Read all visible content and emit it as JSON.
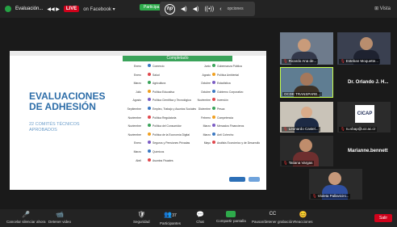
{
  "topbar": {
    "meeting_label": "Evaluación...",
    "controls": "◀◀ ▶",
    "live_label": "LIVE",
    "platform_label": "on Facebook ▾",
    "green_pill": "Participa ✓",
    "hp_logo": "hp",
    "share_icons": [
      "◀)",
      "◀)",
      "((•))",
      "‹"
    ],
    "options_label": "opciones",
    "vista_label": "Vista"
  },
  "slide": {
    "title": "EVALUACIONES DE ADHESIÓN",
    "subtitle": "22 COMITÉS TÉCNICOS APROBADOS",
    "completado_label": "Completado",
    "rows": [
      {
        "d1": "Enero",
        "i1": "Comercio",
        "d2": "Junio",
        "i2": "Gobernanza Pública"
      },
      {
        "d1": "Enero",
        "i1": "Salud",
        "d2": "Agosto",
        "i2": "Política Ambiental"
      },
      {
        "d1": "Marzo",
        "i1": "Agricultura",
        "d2": "Octubre",
        "i2": "Estadística"
      },
      {
        "d1": "Julio",
        "i1": "Política Educativa",
        "d2": "Octubre",
        "i2": "Gobierno Corporativo"
      },
      {
        "d1": "Agosto",
        "i1": "Política Científica y Tecnológica",
        "d2": "Noviembre",
        "i2": "Inversión"
      },
      {
        "d1": "Septiembre",
        "i1": "Empleo, Trabajo y Asuntos Sociales",
        "d2": "Diciembre",
        "i2": "Pesca"
      },
      {
        "d1": "Noviembre",
        "i1": "Política Regulatoria",
        "d2": "Febrero",
        "i2": "Competencia"
      },
      {
        "d1": "Noviembre",
        "i1": "Política del Consumidor",
        "d2": "Marzo",
        "i2": "Mercados Financieros"
      },
      {
        "d1": "Noviembre",
        "i1": "Política de la Economía Digital",
        "d2": "Marzo",
        "i2": "Anti Cohecho"
      },
      {
        "d1": "Enero",
        "i1": "Seguros y Pensiones Privadas",
        "d2": "Mayo",
        "i2": "Análisis Económico y de Desarrollo"
      },
      {
        "d1": "Marzo",
        "i1": "Químicos",
        "d2": "",
        "i2": ""
      },
      {
        "d1": "Abril",
        "i1": "Asuntos Fiscales",
        "d2": "",
        "i2": ""
      }
    ]
  },
  "gallery": {
    "p1": "Ricardo Ana de...",
    "p2": "Esteban Moquette...",
    "p3": "OCDE TRANSPARE...",
    "p4_name": "Dr. Orlando J. H...",
    "p5": "Leonardo Castel...",
    "cicap_logo": "CICAP",
    "p6": "ru.vbap@ucr.ac.cr",
    "p7": "Tatiana Vargas",
    "p8_name": "Marianne.bennett",
    "p9": "Violeta Pallavicini..."
  },
  "bottombar": {
    "items": [
      {
        "icon": "🎤",
        "label": "Cancelar silenciar ahora"
      },
      {
        "icon": "📹",
        "label": "Detener video"
      },
      {
        "icon": "🛡",
        "label": "Seguridad"
      },
      {
        "icon": "👥",
        "label": "Participantes"
      },
      {
        "icon": "💬",
        "label": "Chat"
      },
      {
        "icon": "",
        "label": "Compartir pantalla"
      },
      {
        "icon": "CC",
        "label": "Pausar/detener grabación"
      },
      {
        "icon": "😊",
        "label": "Reacciones"
      }
    ],
    "participants_count": "37",
    "leave_label": "Salir"
  },
  "colors": {
    "accent_green": "#2eaa4b",
    "live_red": "#d0021b",
    "title_blue": "#2d6da8"
  }
}
